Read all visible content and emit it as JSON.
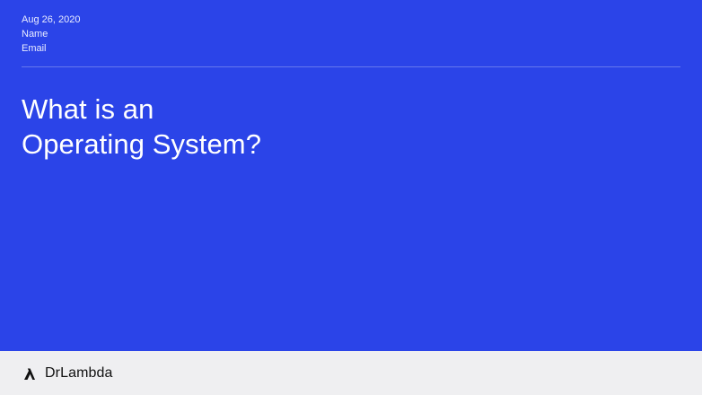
{
  "meta": {
    "date": "Aug 26, 2020",
    "name": "Name",
    "email": "Email"
  },
  "title": {
    "line1": "What is an",
    "line2": "Operating System?"
  },
  "footer": {
    "brand_icon": "lambda-icon",
    "brand_name": "DrLambda"
  },
  "colors": {
    "slide_background": "#2b44e8",
    "footer_background": "#efeff1",
    "text_primary": "#ffffff",
    "brand_text": "#111111"
  }
}
